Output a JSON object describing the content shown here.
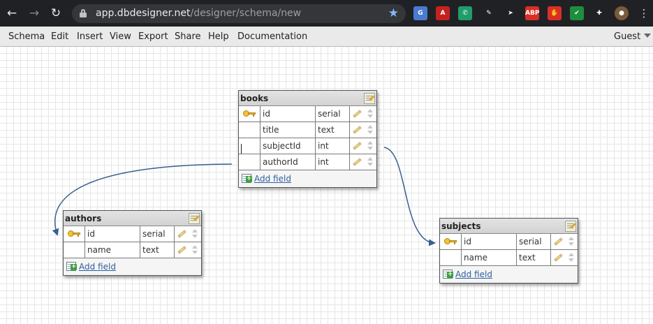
{
  "browser": {
    "url_host": "app.dbdesigner.net",
    "url_path": "/designer/schema/new",
    "extensions": [
      {
        "name": "translate-extension-icon",
        "color": "#4a7bd0",
        "glyph": "G"
      },
      {
        "name": "pdf-extension-icon",
        "color": "#c5221f",
        "glyph": "A"
      },
      {
        "name": "whatsapp-extension-icon",
        "color": "#1f9e6b",
        "glyph": "✆"
      },
      {
        "name": "pen-extension-icon",
        "color": "#202124",
        "glyph": "✎"
      },
      {
        "name": "send-extension-icon",
        "color": "#202124",
        "glyph": "➤"
      },
      {
        "name": "adblock-plus-icon",
        "color": "#d93025",
        "glyph": "ABP"
      },
      {
        "name": "hand-stop-extension-icon",
        "color": "#d93025",
        "glyph": "✋"
      },
      {
        "name": "shield-extension-icon",
        "color": "#1e8e3e",
        "glyph": "✔"
      },
      {
        "name": "puzzle-extensions-icon",
        "color": "#202124",
        "glyph": "✚"
      },
      {
        "name": "profile-avatar",
        "color": "#7a5a3c",
        "glyph": "●"
      }
    ]
  },
  "menu": {
    "items": [
      "Schema",
      "Edit",
      "Insert",
      "View",
      "Export",
      "Share",
      "Help",
      "Documentation"
    ],
    "user": "Guest"
  },
  "tables": [
    {
      "id": "books",
      "name": "books",
      "fields": [
        {
          "name": "id",
          "type": "serial",
          "pk": true
        },
        {
          "name": "title",
          "type": "text",
          "pk": false
        },
        {
          "name": "subjectId",
          "type": "int",
          "pk": false
        },
        {
          "name": "authorId",
          "type": "int",
          "pk": false
        }
      ]
    },
    {
      "id": "authors",
      "name": "authors",
      "fields": [
        {
          "name": "id",
          "type": "serial",
          "pk": true
        },
        {
          "name": "name",
          "type": "text",
          "pk": false
        }
      ]
    },
    {
      "id": "subjects",
      "name": "subjects",
      "fields": [
        {
          "name": "id",
          "type": "serial",
          "pk": true
        },
        {
          "name": "name",
          "type": "text",
          "pk": false
        }
      ]
    }
  ],
  "add_field_label": "Add field",
  "link_color": "#3a5f8f"
}
